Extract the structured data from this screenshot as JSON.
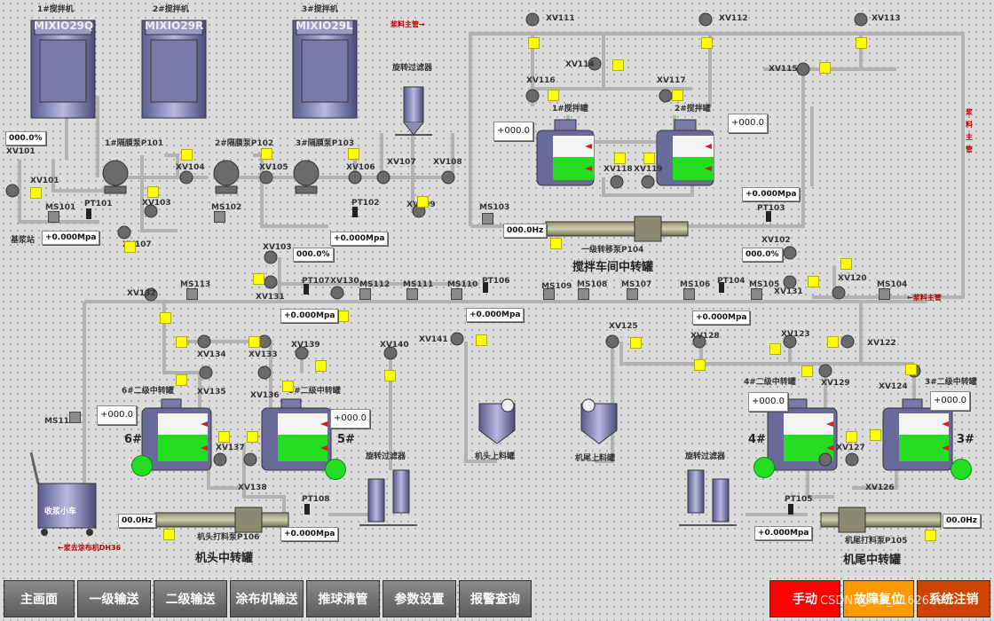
{
  "mixers": [
    {
      "title": "1#搅拌机",
      "model": "MIXIO29Q"
    },
    {
      "title": "2#搅拌机",
      "model": "MIXIO29R"
    },
    {
      "title": "3#搅拌机",
      "model": "MIXIO29L"
    }
  ],
  "labels": {
    "slurry_main_in": "浆料主管→",
    "slurry_main_down": "浆料主管",
    "slurry_main_left": "←浆料主管",
    "to_coater": "←浆去涂布机DH36",
    "pump1": "1#隔膜泵P101",
    "pump2": "2#隔膜泵P102",
    "pump3": "3#隔膜泵P103",
    "filter_top": "旋转过滤器",
    "base_slurry": "基浆站",
    "tank_left": "1#搅拌罐",
    "tank_right": "2#搅拌罐",
    "transfer_pump_top": "一级转移泵P104",
    "tank6": "6#二级中转罐",
    "tank5": "5#二级中转罐",
    "tank4": "4#二级中转罐",
    "tank3": "3#二级中转罐",
    "num6": "6#",
    "num5": "5#",
    "num4": "4#",
    "num3": "3#",
    "head_filter": "旋转过滤器",
    "tail_filter": "旋转过滤器",
    "head_tank": "机头上料罐",
    "tail_tank": "机尾上料罐",
    "cart": "收浆小车",
    "head_pump": "机头打料泵P106",
    "tail_pump": "机尾打料泵P105"
  },
  "sections": {
    "top": "搅拌车间中转罐",
    "head": "机头中转罐",
    "tail": "机尾中转罐"
  },
  "tags": {
    "xv111": "XV111",
    "xv112": "XV112",
    "xv113": "XV113",
    "xv114": "XV114",
    "xv115": "XV115",
    "xv116": "XV116",
    "xv117a": "XV117",
    "xv117b": "XV117",
    "xv118": "XV118",
    "xv119": "XV119",
    "xv101": "XV101",
    "xv101b": "XV101",
    "xv102": "XV102",
    "xv103": "XV103",
    "xv104": "XV104",
    "xv105": "XV105",
    "xv106": "XV106",
    "xv107": "XV107",
    "xv108": "XV108",
    "xv109": "XV109",
    "xv107b": "XV107",
    "xv103b": "XV103",
    "xv131": "XV131",
    "xv132": "XV132",
    "xv130": "XV130",
    "xv131b": "XV131",
    "xv120": "XV120",
    "xv133": "XV133",
    "xv134": "XV134",
    "xv135": "XV135",
    "xv136": "XV136",
    "xv137": "XV137",
    "xv138": "XV138",
    "xv139": "XV139",
    "xv140": "XV140",
    "xv141": "XV141",
    "xv122": "XV122",
    "xv123": "XV123",
    "xv124": "XV124",
    "xv125": "XV125",
    "xv126": "XV126",
    "xv127": "XV127",
    "xv128": "XV128",
    "xv129": "XV129",
    "xv121": "XV121",
    "ms101": "MS101",
    "ms102": "MS102",
    "ms103": "MS103",
    "ms113": "MS113",
    "ms112": "MS112",
    "ms111": "MS111",
    "ms110": "MS110",
    "ms109": "MS109",
    "ms108": "MS108",
    "ms107": "MS107",
    "ms106": "MS106",
    "ms105": "MS105",
    "ms104": "MS104",
    "ms114": "MS114",
    "pt101": "PT101",
    "pt102": "PT102",
    "pt103": "PT103",
    "pt104": "PT104",
    "pt106": "PT106",
    "pt107": "PT107",
    "pt108": "PT108",
    "pt105": "PT105"
  },
  "readouts": {
    "flow_left": "000.0%",
    "p_base": "+0.000Mpa",
    "p_mid": "+0.000Mpa",
    "tank1": "+000.0",
    "tank2": "+000.0",
    "p_tank": "+0.000Mpa",
    "freq_top": "000.0Hz",
    "xv103_pct": "000.0%",
    "xv_right_pct": "000.0%",
    "p_row1": "+0.000Mpa",
    "p_row2": "+0.000Mpa",
    "p_row3": "+0.000Mpa",
    "tank6": "+000.0",
    "tank5": "+000.0",
    "tank4": "+000.0",
    "tank3": "+000.0",
    "freq_head": "00.0Hz",
    "p_head": "+0.000Mpa",
    "p_tail": "+0.000Mpa",
    "freq_tail": "00.0Hz"
  },
  "nav": [
    "主画面",
    "一级输送",
    "二级输送",
    "涂布机输送",
    "推球清管",
    "参数设置",
    "报警查询"
  ],
  "controls": {
    "manual": "手动",
    "fault_reset": "故障复位",
    "logout": "系统注销"
  },
  "control_colors": {
    "manual": "#ff0000",
    "fault_reset": "#ff9900",
    "logout": "#cc4400"
  },
  "watermark": "CSDN @m0_71626391"
}
